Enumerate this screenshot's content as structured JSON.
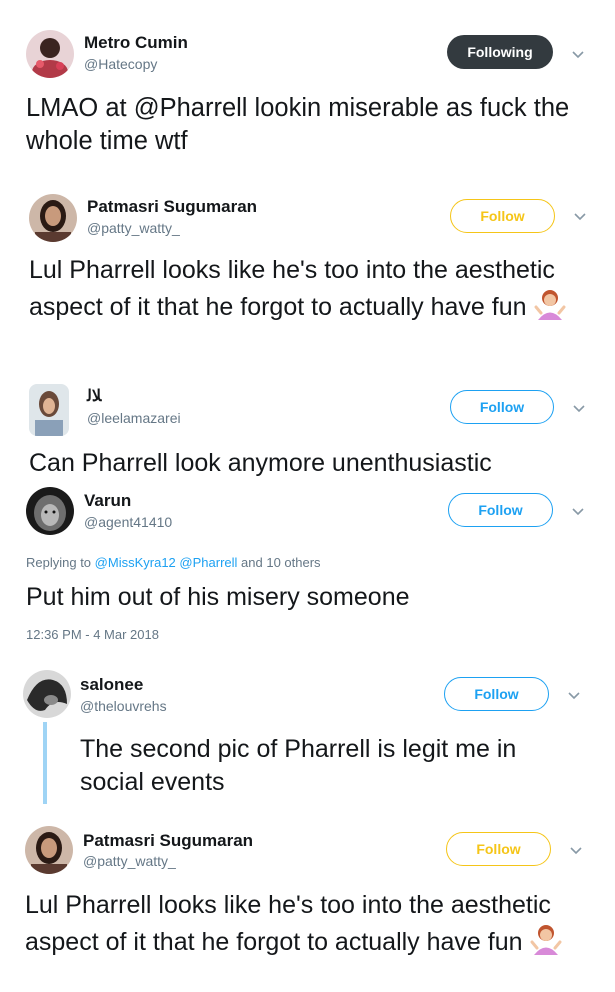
{
  "tweets": [
    {
      "name": "Metro Cumin",
      "handle": "@Hatecopy",
      "button": "Following",
      "text": "LMAO at @Pharrell lookin miserable as fuck the whole time wtf"
    },
    {
      "name": "Patmasri Sugumaran",
      "handle": "@patty_watty_",
      "button": "Follow",
      "text": "Lul Pharrell looks like he's too into the aesthetic aspect of it that he forgot to actually have fun"
    },
    {
      "name": "ﻼﻟ",
      "handle": "@leelamazarei",
      "button": "Follow",
      "text": "Can Pharrell look anymore unenthusiastic"
    },
    {
      "name": "Varun",
      "handle": "@agent41410",
      "button": "Follow",
      "reply_prefix": "Replying to",
      "reply_mention_1": "@MissKyra12",
      "reply_mention_2": "@Pharrell",
      "reply_suffix": "and 10 others",
      "text": "Put him out of his misery someone",
      "timestamp": "12:36 PM - 4 Mar 2018"
    },
    {
      "name": "salonee",
      "handle": "@thelouvrehs",
      "button": "Follow",
      "text": "The second pic of Pharrell is legit me in social events"
    },
    {
      "name": "Patmasri Sugumaran",
      "handle": "@patty_watty_",
      "button": "Follow",
      "text": "Lul Pharrell looks like he's too into the aesthetic aspect of it that he forgot to actually have fun"
    }
  ],
  "icons": {
    "chevron": "chevron-down-icon",
    "emoji": "person-shrugging-emoji"
  },
  "colors": {
    "following_bg": "#333a3f",
    "follow_blue": "#1da1f2",
    "follow_gold": "#f5c518",
    "thread_line": "#9fd4f5"
  }
}
